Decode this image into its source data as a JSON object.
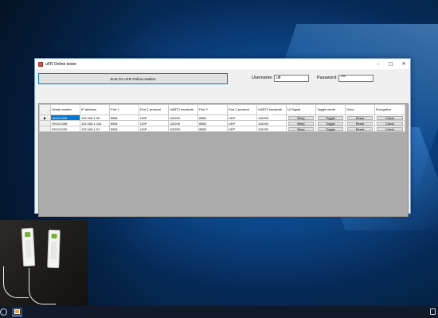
{
  "window": {
    "title": "uFR Online tester",
    "controls": {
      "minimize": "–",
      "maximize": "□",
      "close": "✕"
    }
  },
  "toolbar": {
    "scan_label": "Scan for uFR Online readers",
    "username_label": "Username:",
    "username_value": "ufr",
    "password_label": "Password:",
    "password_value": "***"
  },
  "grid": {
    "columns": [
      "Serial number",
      "IP address",
      "Port 1",
      "Port 1 protocol",
      "UART1 baudrate",
      "Port 2",
      "Port 2 protocol",
      "UART2 baudrate",
      "UI Signal",
      "Toggle mode",
      "Ozne",
      "Encryption"
    ],
    "rows": [
      {
        "caret": "▶",
        "serial": "ON101494",
        "ip": "192.168.1.90",
        "port1": "8881",
        "p1proto": "UDP",
        "uart1": "115200",
        "port2": "8882",
        "p2proto": "UDP",
        "uart2": "115200",
        "ui": "Beep",
        "toggle": "Toggle",
        "ozne": "Reset",
        "enc": "Check"
      },
      {
        "caret": "",
        "serial": "ON101498",
        "ip": "192.168.1.116",
        "port1": "8881",
        "p1proto": "UDP",
        "uart1": "115200",
        "port2": "8882",
        "p2proto": "UDP",
        "uart2": "115200",
        "ui": "Beep",
        "toggle": "Toggle",
        "ozne": "Reset",
        "enc": "Check"
      },
      {
        "caret": "",
        "serial": "ON101290",
        "ip": "192.168.1.91",
        "port1": "8881",
        "p1proto": "UDP",
        "uart1": "115200",
        "port2": "8882",
        "p2proto": "UDP",
        "uart2": "115200",
        "ui": "Beep",
        "toggle": "Toggle",
        "ozne": "Reset",
        "enc": "Check"
      }
    ]
  },
  "colors": {
    "selection": "#0078d7",
    "grid_background": "#ababab",
    "desktop": "#0d4a8f"
  },
  "icons": {
    "app": "app-icon",
    "taskbar_app": "taskbar-app-icon",
    "search": "search-icon",
    "notifications": "notification-icon"
  }
}
